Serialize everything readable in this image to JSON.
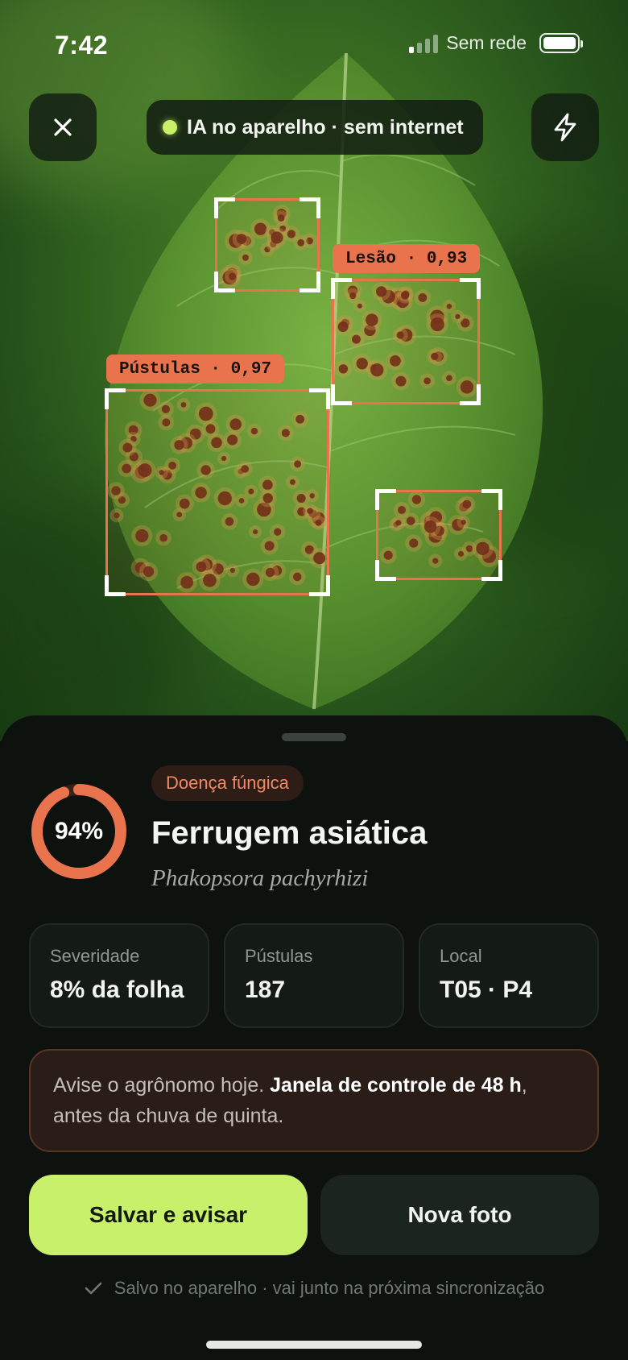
{
  "status_bar": {
    "time": "7:42",
    "network": "Sem rede"
  },
  "top_bar": {
    "close_icon": "close-icon",
    "ai_status": "IA no aparelho · sem internet",
    "flash_icon": "flash-icon"
  },
  "detections": [
    {
      "label": "",
      "shape": "box-1"
    },
    {
      "label": "Lesão · 0,93",
      "shape": "box-2"
    },
    {
      "label": "Pústulas · 0,97",
      "shape": "box-3"
    },
    {
      "label": "",
      "shape": "box-4"
    }
  ],
  "result": {
    "confidence_pct": 94,
    "confidence_label": "94%",
    "category": "Doença fúngica",
    "disease_name": "Ferrugem asiática",
    "scientific_name": "Phakopsora pachyrhizi"
  },
  "stats": [
    {
      "label": "Severidade",
      "value": "8% da folha"
    },
    {
      "label": "Pústulas",
      "value": "187"
    },
    {
      "label": "Local",
      "value": "T05 · P4"
    }
  ],
  "alert": {
    "text_before": "Avise o agrônomo hoje. ",
    "text_bold": "Janela de controle de 48 h",
    "text_after": ", antes da chuva de quinta."
  },
  "actions": {
    "primary": "Salvar e avisar",
    "secondary": "Nova foto"
  },
  "footer_note": "Salvo no aparelho · vai junto na próxima sincronização",
  "colors": {
    "accent": "#c9f06b",
    "detection": "#e8734c",
    "sheet_bg": "#0d120f"
  }
}
